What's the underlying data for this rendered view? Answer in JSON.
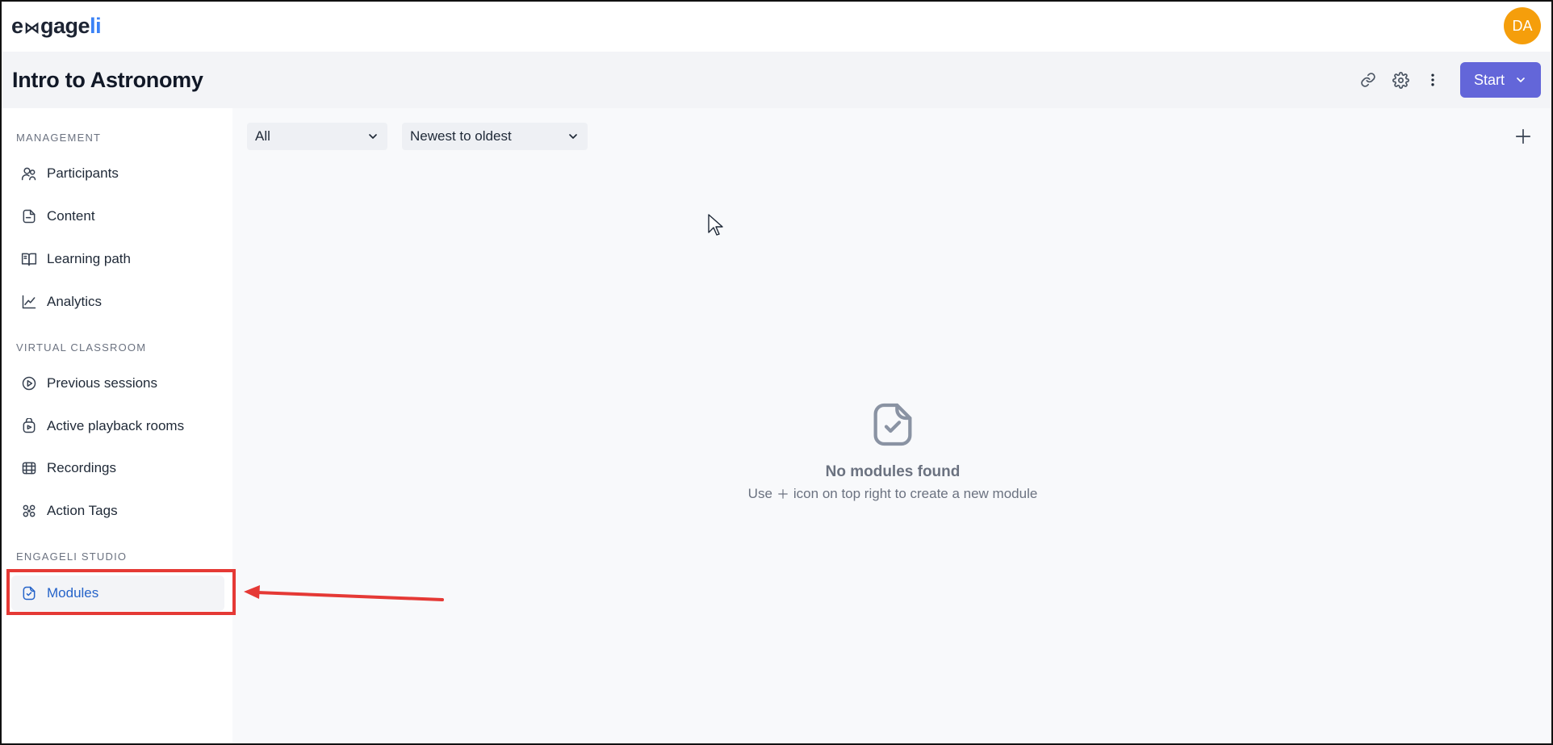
{
  "app": {
    "logo_prefix": "e",
    "logo_mark": "⋈",
    "logo_middle": "gage",
    "logo_suffix": "li",
    "user_initials": "DA"
  },
  "header": {
    "title": "Intro to Astronomy",
    "start_label": "Start",
    "icons": [
      "link-icon",
      "gear-icon",
      "more-vertical-icon"
    ]
  },
  "sidebar": {
    "sections": [
      {
        "label": "MANAGEMENT",
        "items": [
          {
            "label": "Participants",
            "icon": "users-icon"
          },
          {
            "label": "Content",
            "icon": "file-icon"
          },
          {
            "label": "Learning path",
            "icon": "book-icon"
          },
          {
            "label": "Analytics",
            "icon": "chart-line-icon"
          }
        ]
      },
      {
        "label": "VIRTUAL CLASSROOM",
        "items": [
          {
            "label": "Previous sessions",
            "icon": "play-circle-icon"
          },
          {
            "label": "Active playback rooms",
            "icon": "playback-room-icon"
          },
          {
            "label": "Recordings",
            "icon": "film-icon"
          },
          {
            "label": "Action Tags",
            "icon": "tags-icon"
          }
        ]
      },
      {
        "label": "ENGAGELI STUDIO",
        "items": [
          {
            "label": "Modules",
            "icon": "module-icon",
            "active": true
          }
        ]
      }
    ]
  },
  "main": {
    "filter_value": "All",
    "sort_value": "Newest to oldest",
    "empty_title": "No modules found",
    "empty_hint_prefix": "Use",
    "empty_hint_suffix": "icon on top right to create a new module"
  },
  "colors": {
    "accent": "#6366d9",
    "active_link": "#2563c9",
    "avatar": "#f59e0b",
    "highlight": "#e53935"
  }
}
